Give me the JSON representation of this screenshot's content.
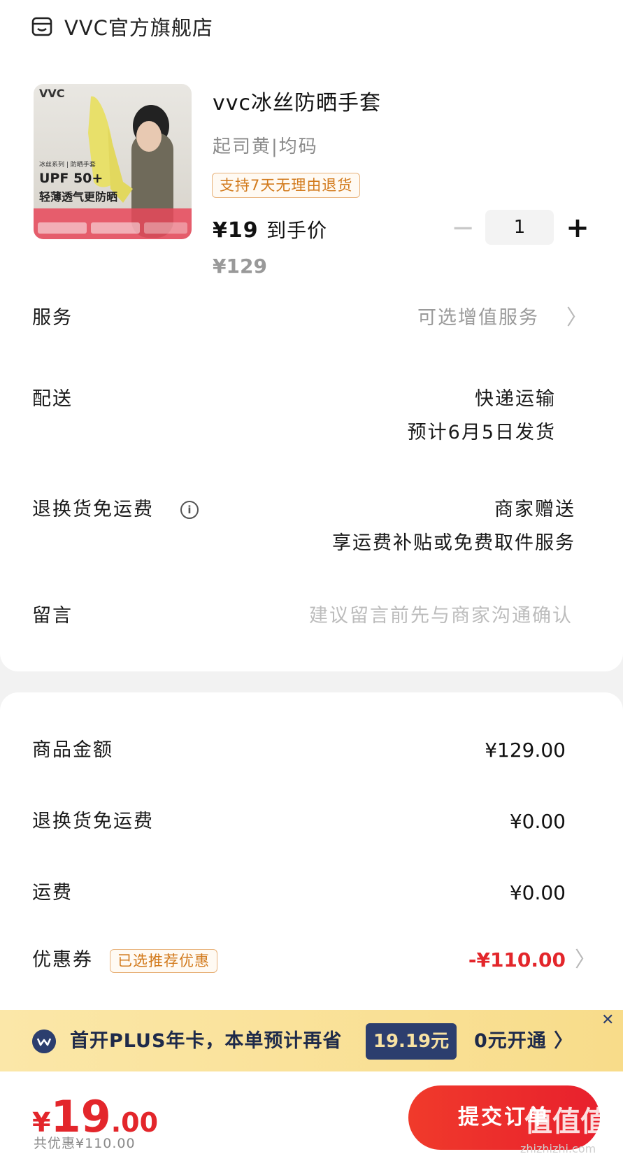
{
  "store": {
    "name": "VVC官方旗舰店"
  },
  "product": {
    "title": "vvc冰丝防晒手套",
    "sku": "起司黄|均码",
    "return_tag": "支持7天无理由退货",
    "final_price": "¥19",
    "final_price_label": "到手价",
    "original_price": "¥129",
    "quantity": "1",
    "image": {
      "brand": "VVC",
      "series": "冰丝系列 | 防晒手套",
      "upf": "UPF 50+",
      "slogan": "轻薄透气更防晒"
    }
  },
  "rows": {
    "service": {
      "label": "服务",
      "value": "可选增值服务"
    },
    "delivery": {
      "label": "配送",
      "value": "快递运输",
      "sub": "预计6月5日发货"
    },
    "return_shipping": {
      "label": "退换货免运费",
      "value": "商家赠送",
      "sub": "享运费补贴或免费取件服务"
    },
    "message": {
      "label": "留言",
      "placeholder": "建议留言前先与商家沟通确认"
    }
  },
  "summary": {
    "goods_amount": {
      "label": "商品金额",
      "value": "¥129.00"
    },
    "return_fee": {
      "label": "退换货免运费",
      "value": "¥0.00"
    },
    "shipping": {
      "label": "运费",
      "value": "¥0.00"
    },
    "coupon": {
      "label": "优惠券",
      "tag": "已选推荐优惠",
      "value": "-¥110.00"
    }
  },
  "plus_banner": {
    "text": "首开PLUS年卡，本单预计再省",
    "amount": "19.19元",
    "action": "0元开通 〉"
  },
  "bottom": {
    "total_yen": "¥",
    "total_int": "19",
    "total_dec": ".00",
    "discount": "共优惠¥110.00",
    "submit": "提交订单",
    "watermark": "值值值",
    "watermark_url": "zhizhizhi.com"
  },
  "colors": {
    "accent_red": "#e3262b",
    "tag_orange": "#d27a1c",
    "plus_navy": "#2c3e6e",
    "plus_gold": "#f8dc8a"
  }
}
